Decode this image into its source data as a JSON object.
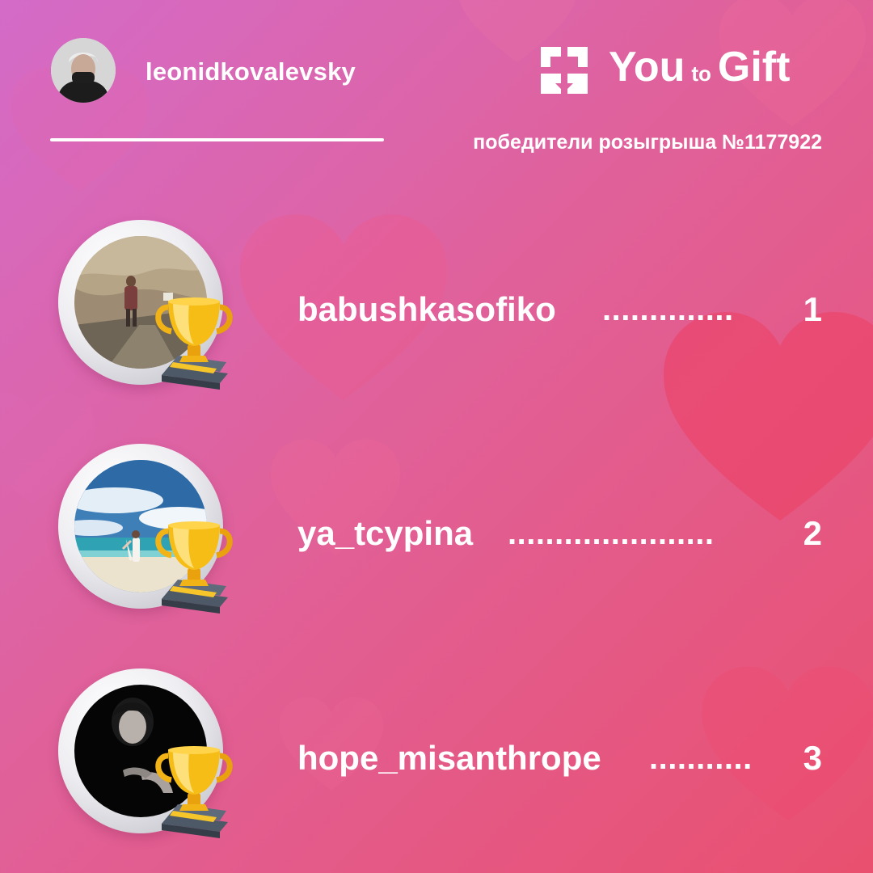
{
  "header": {
    "username": "leonidkovalevsky",
    "subtitle": "победители розыгрыша №1177922"
  },
  "logo": {
    "word1": "You",
    "word2": "to",
    "word3": "Gift"
  },
  "winners": [
    {
      "name": "babushkasofiko",
      "dots": "..............",
      "rank": "1"
    },
    {
      "name": "ya_tcypina",
      "dots": "......................",
      "rank": "2"
    },
    {
      "name": "hope_misanthrope",
      "dots": "...........",
      "rank": "3"
    }
  ],
  "colors": {
    "background_start": "#d46bc8",
    "background_end": "#e9506f",
    "text": "#ffffff",
    "trophy": "#f5b50a"
  },
  "icons": [
    "gift-box-icon",
    "trophy-icon"
  ]
}
